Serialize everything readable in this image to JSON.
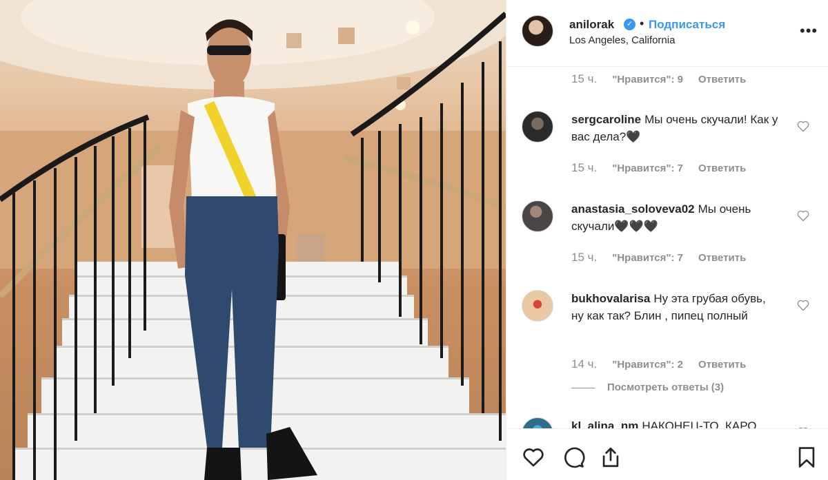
{
  "post": {
    "username": "anilorak",
    "verified_icon": "check-icon",
    "separator": "•",
    "follow_label": "Подписаться",
    "location": "Los Angeles, California",
    "more_label": "•••"
  },
  "comments": [
    {
      "user": "",
      "text": "",
      "time": "15 ч.",
      "likes": "\"Нравится\": 9",
      "reply": "Ответить"
    },
    {
      "user": "sergcaroline",
      "text": "Мы очень скучали! Как у вас дела?🖤",
      "time": "15 ч.",
      "likes": "\"Нравится\": 7",
      "reply": "Ответить"
    },
    {
      "user": "anastasia_soloveva02",
      "text": "Мы очень скучали🖤🖤🖤",
      "time": "15 ч.",
      "likes": "\"Нравится\": 7",
      "reply": "Ответить"
    },
    {
      "user": "bukhovalarisa",
      "text": "Ну эта грубая обувь, ну как так? Блин , пипец полный",
      "time": "14 ч.",
      "likes": "\"Нравится\": 2",
      "reply": "Ответить",
      "view_replies": "Посмотреть ответы (3)"
    },
    {
      "user": "kl_alina_nm",
      "text": "НАКОНЕЦ-ТО, КАРО",
      "time": "",
      "likes": "",
      "reply": ""
    }
  ],
  "actions": {
    "like_icon": "heart-icon",
    "comment_icon": "comment-icon",
    "share_icon": "share-icon",
    "save_icon": "bookmark-icon"
  },
  "colors": {
    "accent": "#3897f0",
    "muted": "#8e8e8e",
    "text": "#262626",
    "border": "#efefef"
  }
}
